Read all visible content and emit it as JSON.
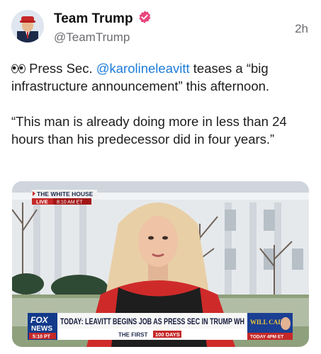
{
  "post": {
    "author_name": "Team Trump",
    "handle": "@TeamTrump",
    "timestamp": "2h",
    "icons": {
      "verified": "verified-badge-icon",
      "eyes": "eyes-emoji-icon"
    },
    "accent_color": "#e8467c",
    "text_line1_prefix": " Press Sec. ",
    "mention": "@karolineleavitt",
    "text_line1_suffix": " teases a “big infrastructure announcement” this afternoon.",
    "text_quote": "“This man is already doing more in less than 24 hours than his predecessor did in four years.”"
  },
  "video": {
    "location_label": "THE WHITE HOUSE",
    "live_label": "LIVE",
    "live_time": "8:10 AM ET",
    "network_name_top": "FOX",
    "network_name_bottom": "NEWS",
    "clock": "5:10 PT",
    "headline": "TODAY: LEAVITT BEGINS JOB AS PRESS SEC IN TRUMP WH",
    "subline_prefix": "THE FIRST",
    "subline_badge": "100 DAYS",
    "promo_show": "WILL CAIN",
    "promo_time": "TODAY 4PM ET"
  }
}
